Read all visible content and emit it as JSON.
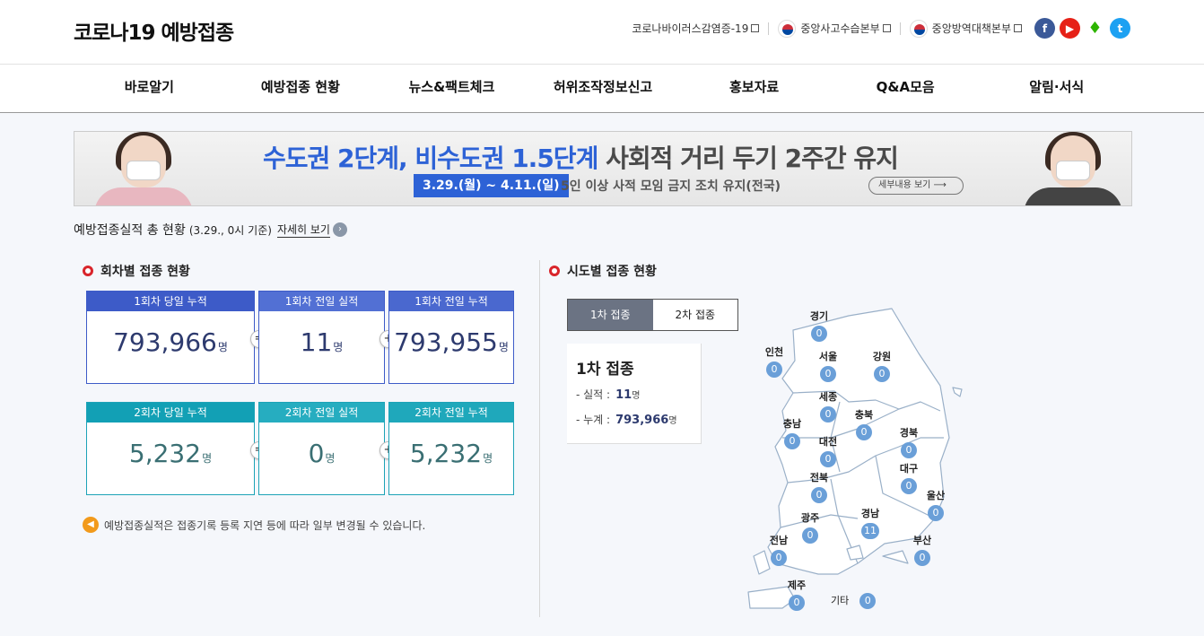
{
  "header": {
    "logo": "코로나19 예방접종",
    "util_links": [
      {
        "label": "코로나바이러스감염증-19"
      },
      {
        "label": "중앙사고수습본부"
      },
      {
        "label": "중앙방역대책본부"
      }
    ],
    "sns": [
      {
        "name": "facebook-icon",
        "glyph": "f"
      },
      {
        "name": "youtube-icon",
        "glyph": "▶"
      },
      {
        "name": "blog-icon",
        "glyph": "♦"
      },
      {
        "name": "twitter-icon",
        "glyph": "t"
      }
    ]
  },
  "nav": [
    "바로알기",
    "예방접종 현황",
    "뉴스&팩트체크",
    "허위조작정보신고",
    "홍보자료",
    "Q&A모음",
    "알림·서식"
  ],
  "banner": {
    "title_blue": "수도권 2단계, 비수도권 1.5단계",
    "title_gray": " 사회적 거리 두기 2주간 유지",
    "date": "3.29.(월) ~ 4.11.(일)",
    "sub": "5인 이상 사적 모임 금지 조치 유지(전국)",
    "more": "세부내용 보기 ⟶"
  },
  "summary": {
    "title": "예방접종실적 총 현황",
    "base": "(3.29., 0시 기준)",
    "detail": "자세히 보기",
    "go": "›"
  },
  "dose_section": {
    "title": "회차별 접종 현황",
    "unit": "명",
    "rows": [
      {
        "boxes": [
          {
            "label": "1회차 당일 누적",
            "value": "793,966"
          },
          {
            "label": "1회차 전일 실적",
            "value": "11"
          },
          {
            "label": "1회차 전일 누적",
            "value": "793,955"
          }
        ],
        "ops": [
          "=",
          "+"
        ],
        "colors": [
          "#3d5bc8",
          "#5270d4",
          "#4a68cf"
        ]
      },
      {
        "boxes": [
          {
            "label": "2회차 당일 누적",
            "value": "5,232"
          },
          {
            "label": "2회차 전일 실적",
            "value": "0"
          },
          {
            "label": "2회차 전일 누적",
            "value": "5,232"
          }
        ],
        "ops": [
          "=",
          "+"
        ],
        "colors": [
          "#12a0b5",
          "#26adc0",
          "#1fa8bb"
        ]
      }
    ],
    "notice": "예방접종실적은 접종기록 등록 지연 등에 따라 일부 변경될 수 있습니다.",
    "notice_icon": "speaker-icon"
  },
  "region_section": {
    "title": "시도별 접종 현황",
    "tabs": [
      "1차 접종",
      "2차 접종"
    ],
    "info": {
      "title": "1차 접종",
      "perf_label": "- 실적 :",
      "perf_value": "11",
      "cum_label": "- 누계 :",
      "cum_value": "793,966",
      "unit": "명"
    },
    "regions": [
      {
        "name": "경기",
        "value": "0"
      },
      {
        "name": "인천",
        "value": "0"
      },
      {
        "name": "서울",
        "value": "0"
      },
      {
        "name": "강원",
        "value": "0"
      },
      {
        "name": "세종",
        "value": "0"
      },
      {
        "name": "충북",
        "value": "0"
      },
      {
        "name": "충남",
        "value": "0"
      },
      {
        "name": "대전",
        "value": "0"
      },
      {
        "name": "경북",
        "value": "0"
      },
      {
        "name": "대구",
        "value": "0"
      },
      {
        "name": "전북",
        "value": "0"
      },
      {
        "name": "울산",
        "value": "0"
      },
      {
        "name": "광주",
        "value": "0"
      },
      {
        "name": "경남",
        "value": "11"
      },
      {
        "name": "부산",
        "value": "0"
      },
      {
        "name": "전남",
        "value": "0"
      },
      {
        "name": "제주",
        "value": "0"
      },
      {
        "name": "기타",
        "value": "0"
      }
    ]
  }
}
